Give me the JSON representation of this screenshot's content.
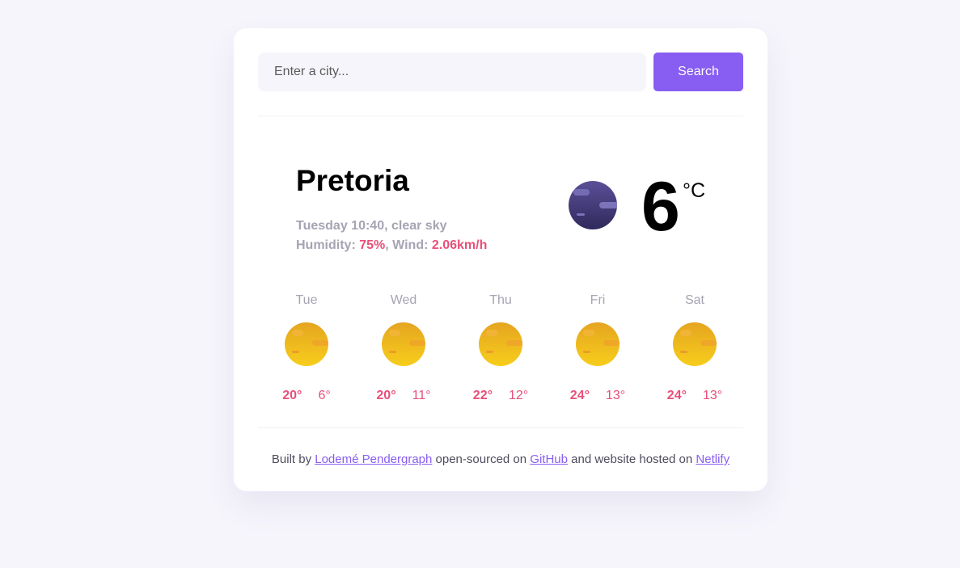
{
  "search": {
    "placeholder": "Enter a city...",
    "button_label": "Search"
  },
  "current": {
    "city": "Pretoria",
    "datetime_desc": "Tuesday 10:40, clear sky",
    "humidity_label": "Humidity: ",
    "humidity_value": "75%",
    "wind_label": ", Wind: ",
    "wind_value": "2.06km/h",
    "temperature": "6",
    "unit": "°C",
    "icon": "night-clear-moon-icon"
  },
  "forecast": [
    {
      "day": "Tue",
      "max": "20°",
      "min": "6°",
      "icon": "sun-icon"
    },
    {
      "day": "Wed",
      "max": "20°",
      "min": "11°",
      "icon": "sun-icon"
    },
    {
      "day": "Thu",
      "max": "22°",
      "min": "12°",
      "icon": "sun-icon"
    },
    {
      "day": "Fri",
      "max": "24°",
      "min": "13°",
      "icon": "sun-icon"
    },
    {
      "day": "Sat",
      "max": "24°",
      "min": "13°",
      "icon": "sun-icon"
    }
  ],
  "footer": {
    "text_1": "Built by ",
    "author_link": "Lodemé Pendergraph",
    "text_2": " open-sourced on ",
    "github_link": "GitHub",
    "text_3": " and website hosted on ",
    "netlify_link": "Netlify"
  },
  "colors": {
    "accent_purple": "#885df1",
    "accent_pink": "#e94f7a",
    "muted_text": "#a7a3b3",
    "background": "#f6f5fc"
  }
}
